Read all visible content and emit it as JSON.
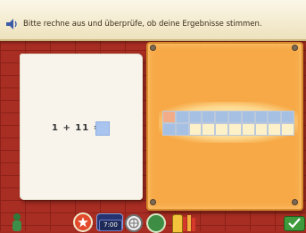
{
  "instruction": {
    "text": "Bitte rechne aus und überprüfe, ob deine Ergebnisse stimmen."
  },
  "exercise": {
    "equation": "1 + 11 =",
    "answer": ""
  },
  "counting_board": {
    "first_row_highlighted_cells": 1,
    "first_row_blue_cells": 10,
    "second_row_blue_cells": 2,
    "cells_per_row": 10,
    "colors": {
      "highlight": "#f2ad88",
      "blue": "#a6c0e4",
      "empty": "#fcf1c8"
    }
  },
  "toolbar": {
    "clock_label": "7:00",
    "icons": [
      "figure-icon",
      "star-icon",
      "clock-icon",
      "globe-icon",
      "doorway-icon",
      "book-icon",
      "checkmark-icon"
    ]
  },
  "colors": {
    "brick": "#a82d22",
    "board": "#f7a947",
    "answer_box": "#a9c4ee"
  }
}
